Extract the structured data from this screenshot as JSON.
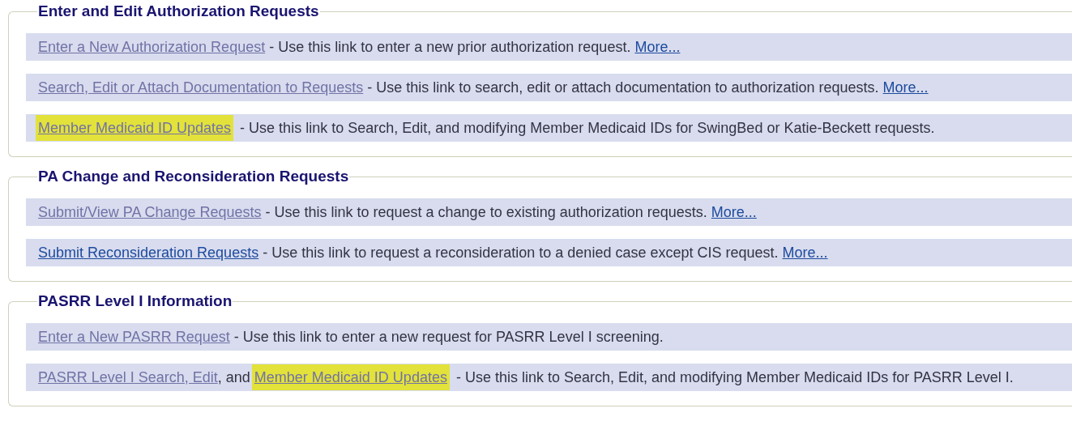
{
  "sections": [
    {
      "title": "Enter and Edit Authorization Requests",
      "rows": [
        {
          "segments": [
            {
              "kind": "link",
              "text": "Enter a New Authorization Request",
              "visited": true,
              "highlighted": false
            },
            {
              "kind": "text",
              "text": " - Use this link to enter a new prior authorization request. "
            },
            {
              "kind": "link",
              "text": "More...",
              "visited": false,
              "highlighted": false
            }
          ]
        },
        {
          "segments": [
            {
              "kind": "link",
              "text": "Search, Edit or Attach Documentation to Requests",
              "visited": true,
              "highlighted": false
            },
            {
              "kind": "text",
              "text": " - Use this link to search, edit or attach documentation to authorization requests. "
            },
            {
              "kind": "link",
              "text": "More...",
              "visited": false,
              "highlighted": false
            }
          ]
        },
        {
          "segments": [
            {
              "kind": "link",
              "text": "Member Medicaid ID Updates",
              "visited": true,
              "highlighted": true
            },
            {
              "kind": "text",
              "text": " - Use this link to Search, Edit, and modifying Member Medicaid IDs for SwingBed or Katie-Beckett requests."
            }
          ]
        }
      ]
    },
    {
      "title": "PA Change and Reconsideration Requests",
      "rows": [
        {
          "segments": [
            {
              "kind": "link",
              "text": "Submit/View PA Change Requests",
              "visited": true,
              "highlighted": false
            },
            {
              "kind": "text",
              "text": " - Use this link to request a change to existing authorization requests. "
            },
            {
              "kind": "link",
              "text": "More...",
              "visited": false,
              "highlighted": false
            }
          ]
        },
        {
          "segments": [
            {
              "kind": "link",
              "text": "Submit Reconsideration Requests",
              "visited": false,
              "highlighted": false
            },
            {
              "kind": "text",
              "text": " - Use this link to request a reconsideration to a denied case except CIS request. "
            },
            {
              "kind": "link",
              "text": "More...",
              "visited": false,
              "highlighted": false
            }
          ]
        }
      ]
    },
    {
      "title": "PASRR Level I Information",
      "rows": [
        {
          "segments": [
            {
              "kind": "link",
              "text": "Enter a New PASRR Request",
              "visited": true,
              "highlighted": false
            },
            {
              "kind": "text",
              "text": " - Use this link to enter a new request for PASRR Level I screening."
            }
          ]
        },
        {
          "segments": [
            {
              "kind": "link",
              "text": "PASRR Level I Search, Edit",
              "visited": true,
              "highlighted": false
            },
            {
              "kind": "text",
              "text": ", and "
            },
            {
              "kind": "link",
              "text": "Member Medicaid ID Updates",
              "visited": true,
              "highlighted": true
            },
            {
              "kind": "text",
              "text": " - Use this link to Search, Edit, and modifying Member Medicaid IDs for PASRR Level I."
            }
          ]
        }
      ]
    }
  ]
}
